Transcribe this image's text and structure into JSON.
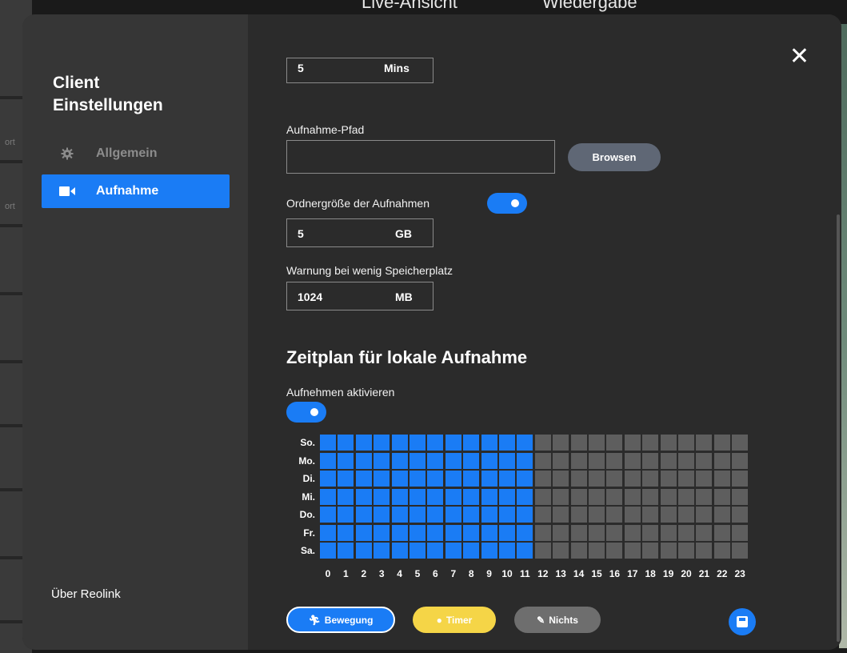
{
  "background": {
    "top_tabs": [
      "Live-Ansicht",
      "Wiedergabe"
    ],
    "left_labels": [
      "ort",
      "ort"
    ]
  },
  "sidebar": {
    "title_line1": "Client",
    "title_line2": "Einstellungen",
    "items": [
      {
        "label": "Allgemein",
        "icon": "gear-icon",
        "active": false
      },
      {
        "label": "Aufnahme",
        "icon": "video-camera-icon",
        "active": true
      }
    ],
    "about": "Über Reolink"
  },
  "content": {
    "top_field": {
      "value": "5",
      "unit": "Mins"
    },
    "path": {
      "label": "Aufnahme-Pfad",
      "value": "",
      "browse_label": "Browsen"
    },
    "folder_size": {
      "label": "Ordnergröße der Aufnahmen",
      "enabled": true,
      "value": "5",
      "unit": "GB"
    },
    "low_space": {
      "label": "Warnung bei wenig Speicherplatz",
      "value": "1024",
      "unit": "MB"
    },
    "schedule": {
      "heading": "Zeitplan für lokale Aufnahme",
      "enable_label": "Aufnehmen aktivieren",
      "enabled": true,
      "days": [
        "So.",
        "Mo.",
        "Di.",
        "Mi.",
        "Do.",
        "Fr.",
        "Sa."
      ],
      "hours": [
        "0",
        "1",
        "2",
        "3",
        "4",
        "5",
        "6",
        "7",
        "8",
        "9",
        "10",
        "11",
        "12",
        "13",
        "14",
        "15",
        "16",
        "17",
        "18",
        "19",
        "20",
        "21",
        "22",
        "23"
      ],
      "active_hours": [
        0,
        1,
        2,
        3,
        4,
        5,
        6,
        7,
        8,
        9,
        10,
        11
      ],
      "colors": {
        "on": "#1a7cf5",
        "off": "#5e5e5e"
      }
    },
    "legend": [
      {
        "label": "Bewegung",
        "icon": "running-person-icon",
        "color": "#1a7cf5",
        "selected": true
      },
      {
        "label": "Timer",
        "icon": "clock-icon",
        "color": "#f5d547",
        "selected": false
      },
      {
        "label": "Nichts",
        "icon": "eraser-icon",
        "color": "#6e6e6e",
        "selected": false
      }
    ]
  },
  "colors": {
    "accent": "#1a7cf5",
    "modal_bg": "#2b2b2b",
    "sidebar_bg": "#363636"
  }
}
